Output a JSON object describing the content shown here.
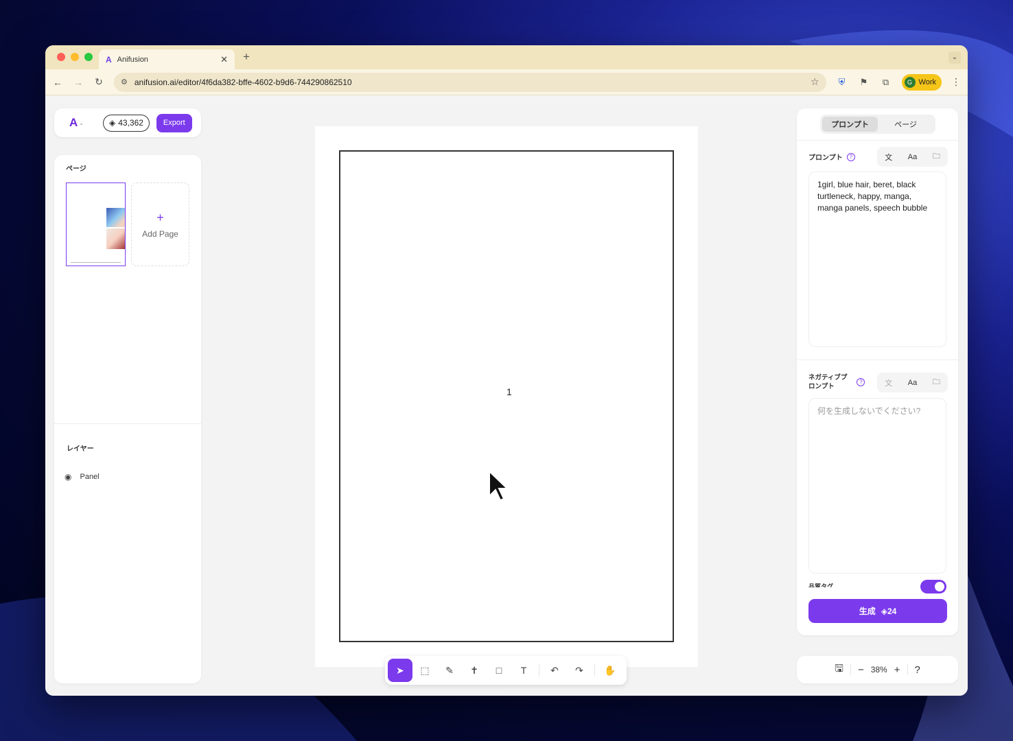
{
  "browser": {
    "tab_title": "Anifusion",
    "tab_favicon": "anifusion-logo-icon",
    "url": "anifusion.ai/editor/4f6da382-bffe-4602-b9d6-744290862510",
    "profile_initial": "G",
    "profile_label": "Work"
  },
  "app": {
    "credits": "43,362",
    "export_label": "Export",
    "accent_color": "#7c3aed"
  },
  "pages_panel": {
    "title": "ページ",
    "add_page_label": "Add Page"
  },
  "layers_panel": {
    "title": "レイヤー",
    "items": [
      {
        "label": "Panel"
      }
    ]
  },
  "canvas": {
    "panel_number": "1"
  },
  "toolbar": {
    "tools": [
      "select-icon",
      "marquee-icon",
      "brush-icon",
      "pose-icon",
      "rectangle-icon",
      "text-icon",
      "undo-icon",
      "redo-icon",
      "hand-icon"
    ],
    "active_tool": "select-icon"
  },
  "right_panel": {
    "tabs": [
      {
        "label": "プロンプト"
      },
      {
        "label": "ページ"
      }
    ],
    "active_tab": "プロンプト",
    "prompt": {
      "label": "プロンプト",
      "value": "1girl, blue hair, beret, black turtleneck, happy, manga, manga panels, speech bubble"
    },
    "negative_prompt": {
      "label_line1": "ネガティブプ",
      "label_line2": "ロンプト",
      "placeholder": "何を生成しないでください?"
    },
    "quality_tags_label": "品質タグ",
    "quality_tags_enabled": true,
    "generate_label": "生成",
    "generate_cost": "24"
  },
  "zoom": {
    "level": "38%"
  }
}
